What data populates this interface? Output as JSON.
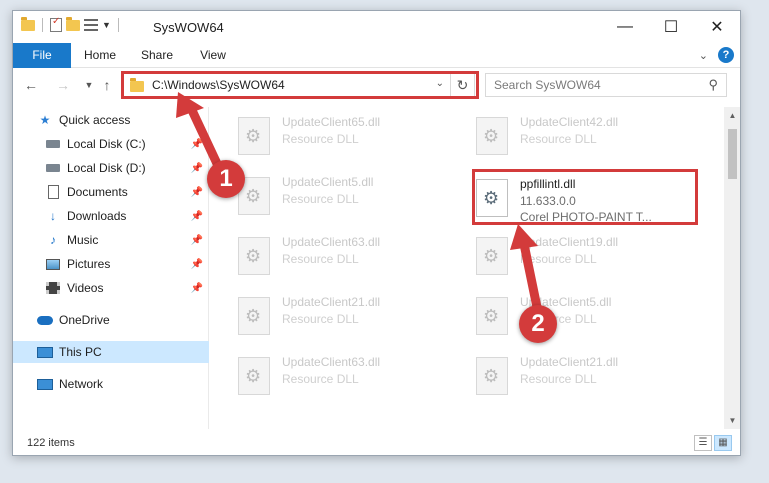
{
  "window": {
    "title": "SysWOW64",
    "controls": {
      "minimize": "—",
      "maximize": "☐",
      "close": "✕"
    }
  },
  "ribbon": {
    "tabs": [
      "File",
      "Home",
      "Share",
      "View"
    ],
    "help_label": "?"
  },
  "nav": {
    "address": "C:\\Windows\\SysWOW64",
    "search_placeholder": "Search SysWOW64"
  },
  "sidebar": {
    "items": [
      {
        "label": "Quick access",
        "icon": "star-icon"
      },
      {
        "label": "Local Disk (C:)",
        "icon": "drive-icon",
        "pinned": true
      },
      {
        "label": "Local Disk (D:)",
        "icon": "drive-icon",
        "pinned": true
      },
      {
        "label": "Documents",
        "icon": "document-icon",
        "pinned": true
      },
      {
        "label": "Downloads",
        "icon": "download-icon",
        "pinned": true
      },
      {
        "label": "Music",
        "icon": "music-icon",
        "pinned": true
      },
      {
        "label": "Pictures",
        "icon": "pictures-icon",
        "pinned": true
      },
      {
        "label": "Videos",
        "icon": "videos-icon",
        "pinned": true
      },
      {
        "label": "OneDrive",
        "icon": "onedrive-icon"
      },
      {
        "label": "This PC",
        "icon": "this-pc-icon",
        "selected": true
      },
      {
        "label": "Network",
        "icon": "network-icon"
      }
    ]
  },
  "files": [
    {
      "name": "UpdateClient65.dll",
      "desc": "Resource DLL"
    },
    {
      "name": "UpdateClient42.dll",
      "desc": "Resource DLL"
    },
    {
      "name": "UpdateClient5.dll",
      "desc": "Resource DLL"
    },
    {
      "name": "ppfillintl.dll",
      "desc": "11.633.0.0",
      "desc2": "Corel PHOTO-PAINT T...",
      "active": true
    },
    {
      "name": "UpdateClient63.dll",
      "desc": "Resource DLL"
    },
    {
      "name": "UpdateClient19.dll",
      "desc": "Resource DLL"
    },
    {
      "name": "UpdateClient21.dll",
      "desc": "Resource DLL"
    },
    {
      "name": "UpdateClient5.dll",
      "desc": "Resource DLL"
    },
    {
      "name": "UpdateClient63.dll",
      "desc": "Resource DLL"
    },
    {
      "name": "UpdateClient21.dll",
      "desc": "Resource DLL"
    }
  ],
  "status": {
    "item_count": "122 items"
  },
  "annotations": {
    "step1": "1",
    "step2": "2",
    "color": "#d33b3b"
  }
}
